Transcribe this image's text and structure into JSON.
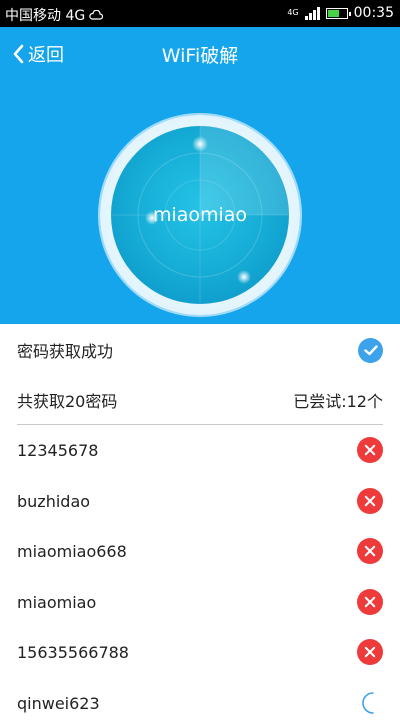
{
  "statusbar": {
    "carrier": "中国移动 4G",
    "network_tag": "4G",
    "time": "00:35"
  },
  "header": {
    "back_label": "返回",
    "title": "WiFi破解",
    "ssid": "miaomiao"
  },
  "status": {
    "message": "密码获取成功"
  },
  "summary": {
    "total_label": "共获取20密码",
    "tried_label": "已尝试:12个"
  },
  "passwords": [
    {
      "value": "12345678",
      "state": "failed"
    },
    {
      "value": "buzhidao",
      "state": "failed"
    },
    {
      "value": "miaomiao668",
      "state": "failed"
    },
    {
      "value": "miaomiao",
      "state": "failed"
    },
    {
      "value": "15635566788",
      "state": "failed"
    },
    {
      "value": "qinwei623",
      "state": "trying"
    }
  ],
  "colors": {
    "header_bg": "#14a5ed",
    "fail": "#ee3a3a",
    "success": "#3ca2ea"
  }
}
